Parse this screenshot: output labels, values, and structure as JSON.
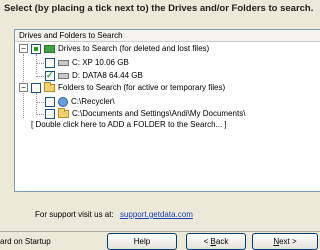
{
  "instruction": "Select (by placing a tick next to) the Drives and/or Folders to search.",
  "tree": {
    "header": "Drives and Folders to Search",
    "drives_node": "Drives to Search (for deleted and lost files)",
    "drives": [
      {
        "label": "C: XP  10.06 GB",
        "checked": false
      },
      {
        "label": "D: DATA8  64.44 GB",
        "checked": true
      }
    ],
    "folders_node": "Folders to Search (for active or temporary files)",
    "folders": [
      {
        "label": "C:\\Recycler\\"
      },
      {
        "label": "C:\\Documents and Settings\\Andi\\My Documents\\"
      }
    ],
    "add_folder": "[ Double click here to ADD a FOLDER to the Search... ]"
  },
  "support": {
    "label": "For support visit us at:",
    "link": "support.getdata.com"
  },
  "footer": {
    "startup_label": "ard on Startup",
    "help": "Help",
    "back_prefix": "< ",
    "back_key": "B",
    "back_rest": "ack",
    "next_key": "N",
    "next_rest": "ext >"
  }
}
